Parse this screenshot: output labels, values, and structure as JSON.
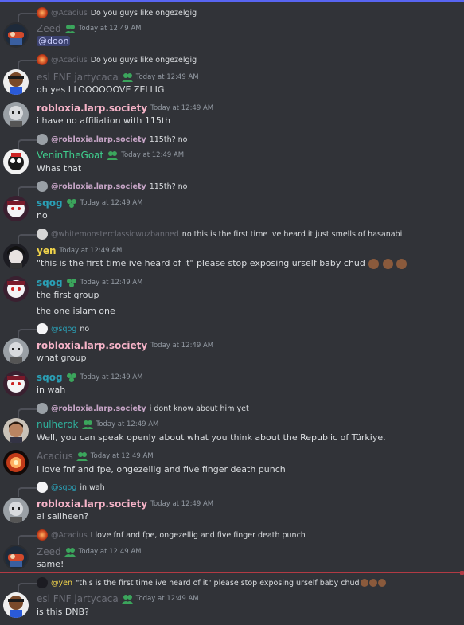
{
  "messages": [
    {
      "reply": {
        "username": "@Acacius",
        "text": "Do you guys like ongezelgig"
      },
      "username": "Zeed",
      "timestamp": "Today at 12:49 AM",
      "lines": [],
      "mention": "@doon"
    },
    {
      "reply": {
        "username": "@Acacius",
        "text": "Do you guys like ongezelgig"
      },
      "username": "esl FNF jartycaca",
      "timestamp": "Today at 12:49 AM",
      "lines": [
        "oh yes I LOOOOOOVE ZELLIG"
      ]
    },
    {
      "username": "robloxia.larp.society",
      "timestamp": "Today at 12:49 AM",
      "lines": [
        "i have no affiliation with 115th"
      ]
    },
    {
      "reply": {
        "username": "@robloxia.larp.society",
        "text": "115th? no"
      },
      "username": "VeninTheGoat",
      "timestamp": "Today at 12:49 AM",
      "lines": [
        "Whas that"
      ]
    },
    {
      "reply": {
        "username": "@robloxia.larp.society",
        "text": "115th? no"
      },
      "username": "sqog",
      "timestamp": "Today at 12:49 AM",
      "lines": [
        "no"
      ]
    },
    {
      "reply": {
        "username": "@whitemonsterclassicwuzbanned",
        "text": "no this is the first time ive heard it just smells of hasanabi"
      },
      "username": "yen",
      "timestamp": "Today at 12:49 AM",
      "lines": [
        "\"this is the first time ive heard of it\" please stop exposing urself baby chud"
      ]
    },
    {
      "username": "sqog",
      "timestamp": "Today at 12:49 AM",
      "lines": [
        "the first group",
        "the one islam one"
      ]
    },
    {
      "reply": {
        "username": "@sqog",
        "text": "no"
      },
      "username": "robloxia.larp.society",
      "timestamp": "Today at 12:49 AM",
      "lines": [
        "what group"
      ]
    },
    {
      "username": "sqog",
      "timestamp": "Today at 12:49 AM",
      "lines": [
        "in wah"
      ]
    },
    {
      "reply": {
        "username": "@robloxia.larp.society",
        "text": "i dont know about him yet"
      },
      "username": "nulherok",
      "timestamp": "Today at 12:49 AM",
      "lines": [
        "Well, you can speak openly about what you think about the Republic of Türkiye."
      ]
    },
    {
      "username": "Acacius",
      "timestamp": "Today at 12:49 AM",
      "lines": [
        "I love fnf and fpe, ongezellig and five finger death punch"
      ]
    },
    {
      "reply": {
        "username": "@sqog",
        "text": "in wah"
      },
      "username": "robloxia.larp.society",
      "timestamp": "Today at 12:49 AM",
      "lines": [
        "al saliheen?"
      ]
    },
    {
      "reply": {
        "username": "@Acacius",
        "text": "I love fnf and fpe, ongezellig and five finger death punch"
      },
      "username": "Zeed",
      "timestamp": "Today at 12:49 AM",
      "lines": [
        "same!"
      ]
    },
    {
      "reply": {
        "username": "@yen",
        "text": "\"this is the first time ive heard of it\" please stop exposing urself baby chud"
      },
      "username": "esl FNF jartycaca",
      "timestamp": "Today at 12:49 AM",
      "lines": [
        "is this DNB?"
      ]
    }
  ],
  "colors": {
    "background": "#313338",
    "divider": "#b23a44",
    "accent": "#5865f2"
  },
  "icons": [
    "green-people-badge-icon",
    "bear-emoji-icon"
  ]
}
